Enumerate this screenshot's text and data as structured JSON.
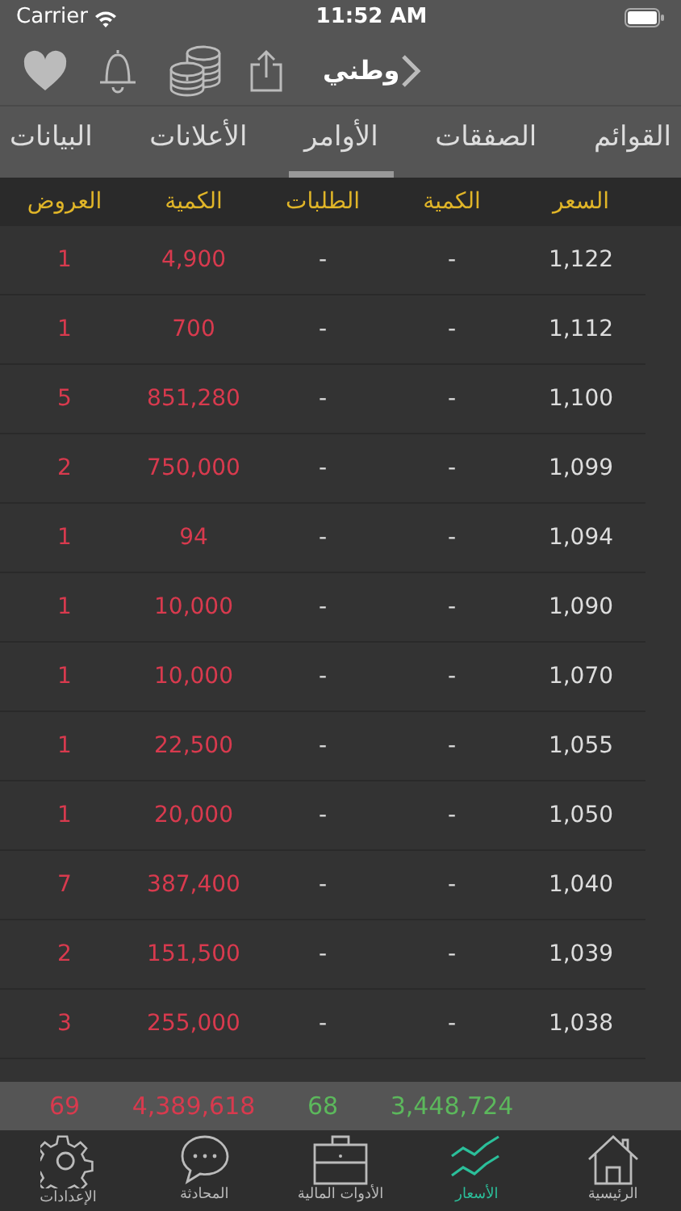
{
  "status_bar": {
    "carrier": "Carrier",
    "time": "11:52 AM"
  },
  "toolbar": {
    "title": "وطني"
  },
  "tabs": [
    {
      "label": "القوائم",
      "selected": false
    },
    {
      "label": "الصفقات",
      "selected": false
    },
    {
      "label": "الأوامر",
      "selected": true
    },
    {
      "label": "الأعلانات",
      "selected": false
    },
    {
      "label": "البيانات",
      "selected": false
    }
  ],
  "table": {
    "columns": [
      "السعر",
      "الكمية",
      "الطلبات",
      "الكمية",
      "العروض"
    ],
    "rows": [
      [
        "1,122",
        "-",
        "-",
        "4,900",
        "1"
      ],
      [
        "1,112",
        "-",
        "-",
        "700",
        "1"
      ],
      [
        "1,100",
        "-",
        "-",
        "851,280",
        "5"
      ],
      [
        "1,099",
        "-",
        "-",
        "750,000",
        "2"
      ],
      [
        "1,094",
        "-",
        "-",
        "94",
        "1"
      ],
      [
        "1,090",
        "-",
        "-",
        "10,000",
        "1"
      ],
      [
        "1,070",
        "-",
        "-",
        "10,000",
        "1"
      ],
      [
        "1,055",
        "-",
        "-",
        "22,500",
        "1"
      ],
      [
        "1,050",
        "-",
        "-",
        "20,000",
        "1"
      ],
      [
        "1,040",
        "-",
        "-",
        "387,400",
        "7"
      ],
      [
        "1,039",
        "-",
        "-",
        "151,500",
        "2"
      ],
      [
        "1,038",
        "-",
        "-",
        "255,000",
        "3"
      ]
    ]
  },
  "totals": {
    "bid_quantity": "3,448,724",
    "bids": "68",
    "ask_quantity": "4,389,618",
    "asks": "69"
  },
  "bottom_tabs": [
    {
      "label": "الرئيسية",
      "kind": "home",
      "selected": false
    },
    {
      "label": "الأسعار",
      "kind": "chart",
      "selected": true
    },
    {
      "label": "الأدوات المالية",
      "kind": "briefcase",
      "selected": false
    },
    {
      "label": "المحادثة",
      "kind": "chat",
      "selected": false
    },
    {
      "label": "الإعدادات",
      "kind": "gear",
      "selected": false
    }
  ]
}
